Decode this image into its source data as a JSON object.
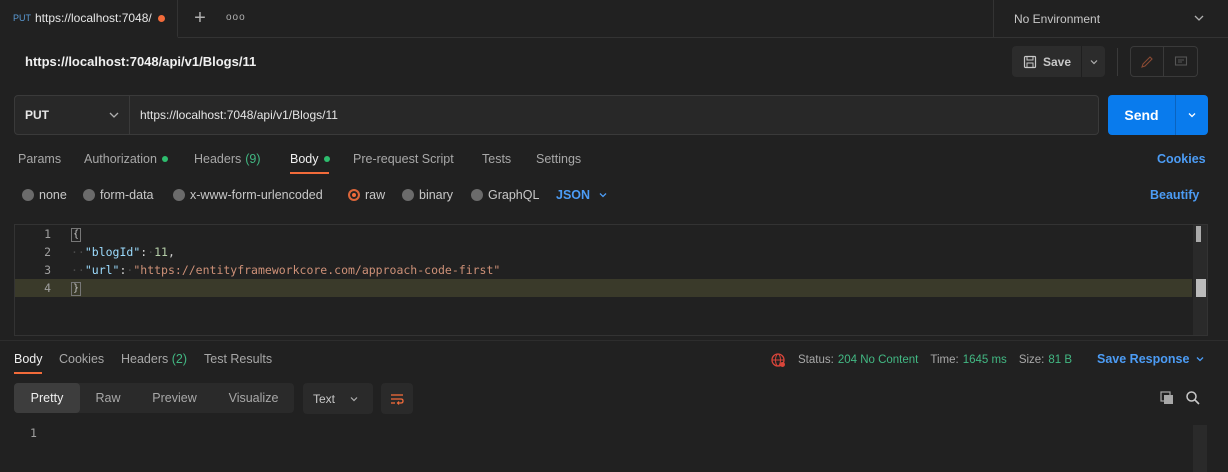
{
  "tab": {
    "method": "PUT",
    "url": "https://localhost:7048/"
  },
  "tabbar": {
    "more": "ooo"
  },
  "environment": {
    "label": "No Environment"
  },
  "request": {
    "title": "https://localhost:7048/api/v1/Blogs/11",
    "save_label": "Save",
    "method": "PUT",
    "url": "https://localhost:7048/api/v1/Blogs/11",
    "send_label": "Send"
  },
  "request_tabs": {
    "params": "Params",
    "authorization": "Authorization",
    "headers": "Headers",
    "headers_count": "(9)",
    "body": "Body",
    "prerequest": "Pre-request Script",
    "tests": "Tests",
    "settings": "Settings",
    "cookies": "Cookies"
  },
  "body_types": {
    "none": "none",
    "form_data": "form-data",
    "urlencoded": "x-www-form-urlencoded",
    "raw": "raw",
    "binary": "binary",
    "graphql": "GraphQL",
    "format": "JSON",
    "beautify": "Beautify"
  },
  "editor": {
    "line_numbers": [
      "1",
      "2",
      "3",
      "4"
    ],
    "open_brace": "{",
    "close_brace": "}",
    "key1": "\"blogId\"",
    "val1": "11",
    "key2": "\"url\"",
    "val2": "\"https://entityframeworkcore.com/approach-code-first\""
  },
  "response_tabs": {
    "body": "Body",
    "cookies": "Cookies",
    "headers": "Headers",
    "headers_count": "(2)",
    "test_results": "Test Results"
  },
  "response_meta": {
    "status_label": "Status:",
    "status_value": "204 No Content",
    "time_label": "Time:",
    "time_value": "1645 ms",
    "size_label": "Size:",
    "size_value": "81 B",
    "save_response": "Save Response"
  },
  "view_modes": {
    "pretty": "Pretty",
    "raw": "Raw",
    "preview": "Preview",
    "visualize": "Visualize",
    "format": "Text"
  },
  "response_body": {
    "line_numbers": [
      "1"
    ]
  },
  "colors": {
    "accent": "#f26b3a",
    "send": "#097bed",
    "link": "#4c9cf5",
    "success": "#42b883"
  }
}
